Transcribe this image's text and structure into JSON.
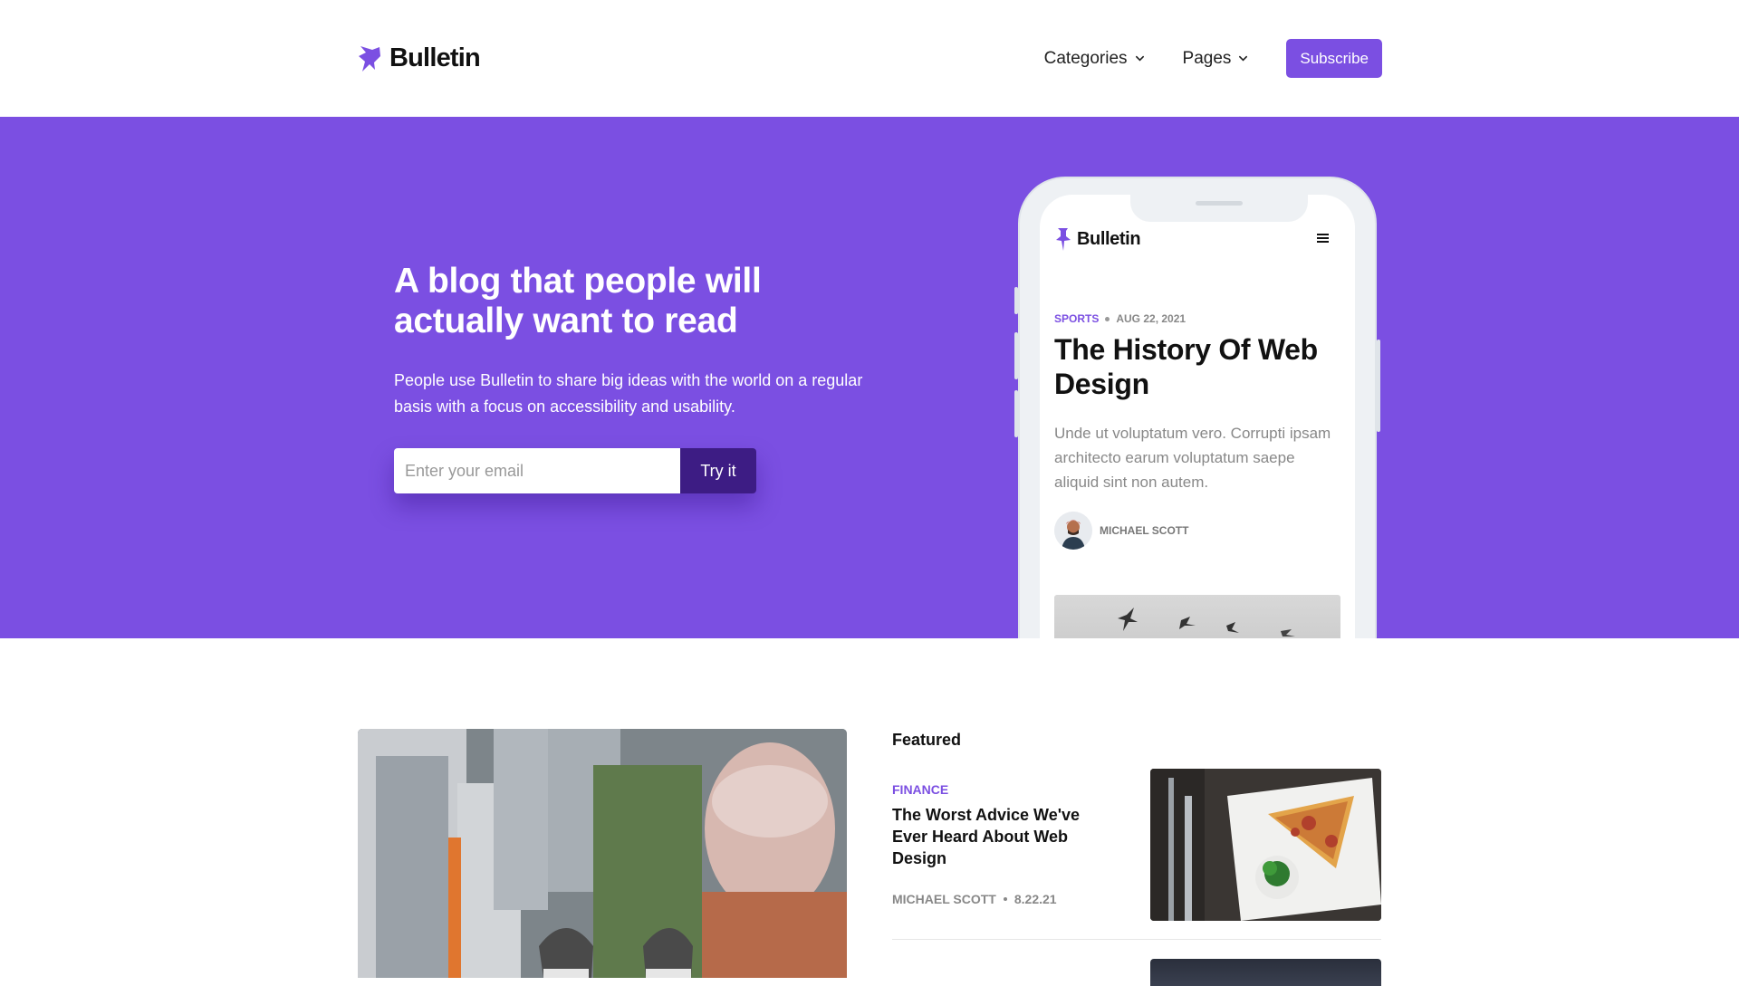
{
  "brand": {
    "name": "Bulletin",
    "accent": "#7b4fe2",
    "dark_accent": "#3d1c84"
  },
  "nav": {
    "items": [
      {
        "label": "Categories",
        "icon": "chevron-down-icon"
      },
      {
        "label": "Pages",
        "icon": "chevron-down-icon"
      }
    ],
    "subscribe_label": "Subscribe"
  },
  "hero": {
    "title": "A blog that people will actually want to read",
    "subtitle": "People use Bulletin to share big ideas with the world on a regular basis with a focus on accessibility and usability.",
    "email_placeholder": "Enter your email",
    "cta_label": "Try it"
  },
  "phone_preview": {
    "brand": "Bulletin",
    "menu_icon": "hamburger-icon",
    "category": "SPORTS",
    "date": "AUG 22, 2021",
    "title": "The History Of Web Design",
    "excerpt": "Unde ut voluptatum vero. Corrupti ipsam architecto earum voluptatum saepe aliquid sint non autem.",
    "author": "MICHAEL SCOTT"
  },
  "featured": {
    "heading": "Featured",
    "cards": [
      {
        "category": "FINANCE",
        "title": "The Worst Advice We've Ever Heard About Web Design",
        "author": "MICHAEL SCOTT",
        "date": "8.22.21"
      }
    ]
  }
}
